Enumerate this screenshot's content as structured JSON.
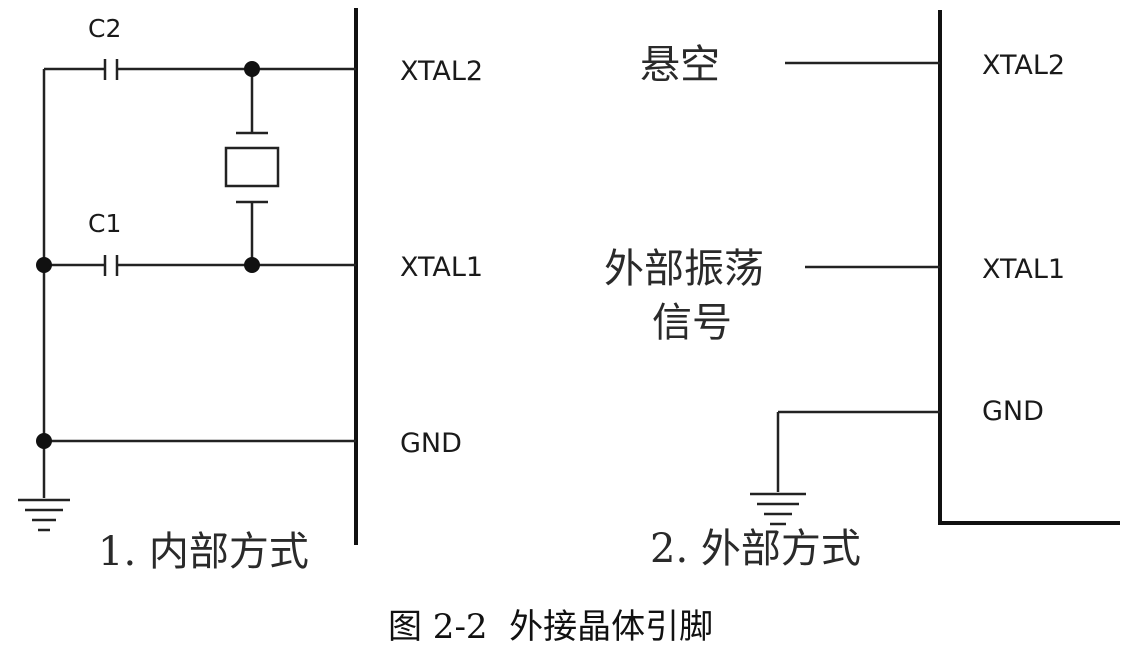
{
  "left_panel": {
    "capacitors": {
      "top": "C2",
      "bottom": "C1"
    },
    "pins": {
      "xtal2": "XTAL2",
      "xtal1": "XTAL1",
      "gnd": "GND"
    },
    "caption": "1. 内部方式"
  },
  "right_panel": {
    "pins": {
      "xtal2": "XTAL2",
      "xtal1": "XTAL1",
      "gnd": "GND"
    },
    "floating_label": "悬空",
    "external_signal_line1": "外部振荡",
    "external_signal_line2": "信号",
    "caption": "2. 外部方式"
  },
  "figure_caption": "图 2-2  外接晶体引脚"
}
